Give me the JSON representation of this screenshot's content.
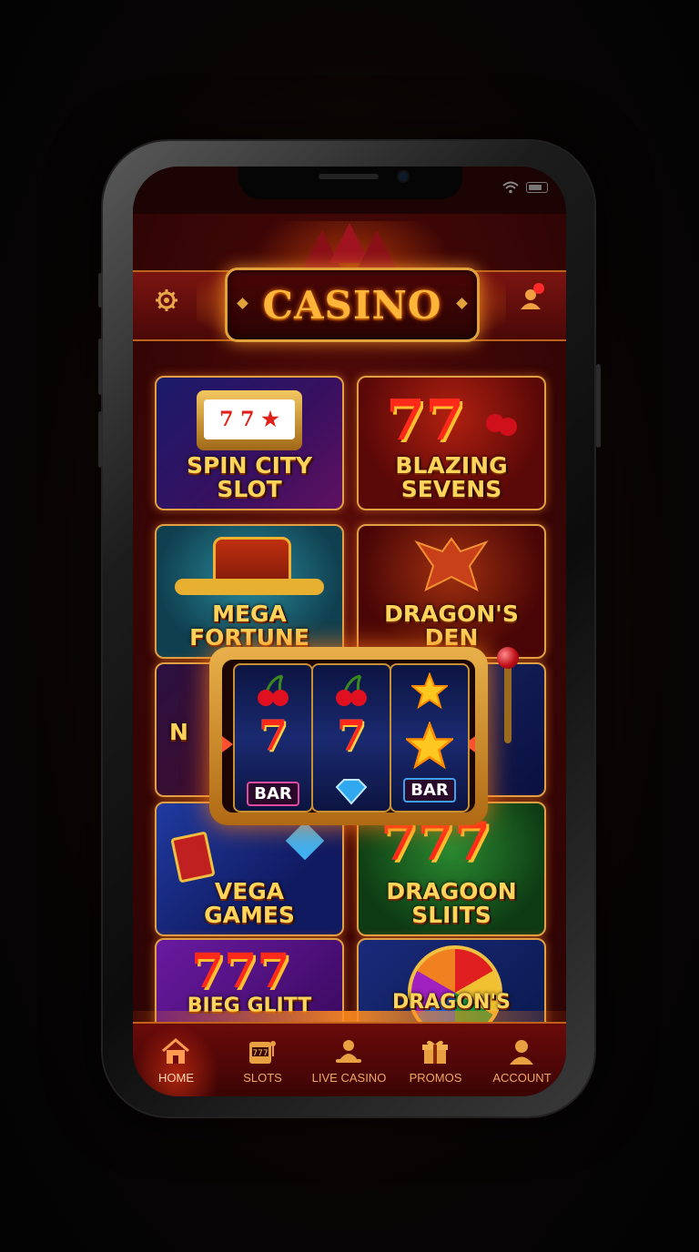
{
  "app": {
    "logo_text": "CASINO"
  },
  "header": {
    "settings_icon": "gear-icon",
    "account_icon": "user-icon",
    "notification": true
  },
  "games": [
    {
      "title_line1": "SPIN CITY",
      "title_line2": "SLOT",
      "theme": "slot-machine"
    },
    {
      "title_line1": "BLAZING",
      "title_line2": "SEVENS",
      "theme": "sevens-cherries"
    },
    {
      "title_line1": "MEGA",
      "title_line2": "FORTUNE",
      "theme": "treasure-chest"
    },
    {
      "title_line1": "DRAGON'S",
      "title_line2": "DEN",
      "theme": "dragon"
    },
    {
      "title_line1": "N",
      "title_line2": "",
      "theme": "partially-hidden"
    },
    {
      "title_line1": "",
      "title_line2": "",
      "theme": "partially-hidden"
    },
    {
      "title_line1": "VEGA",
      "title_line2": "GAMES",
      "theme": "cards-gems"
    },
    {
      "title_line1": "DRAGOON",
      "title_line2": "SLIITS",
      "theme": "triple-sevens"
    },
    {
      "title_line1": "BIEG GLITT",
      "title_line2": "",
      "theme": "triple-sevens"
    },
    {
      "title_line1": "DRAGON'S",
      "title_line2": "",
      "theme": "wheel"
    }
  ],
  "featured_slot": {
    "reels": [
      {
        "top": "cherries",
        "middle": "7",
        "bottom": "BAR"
      },
      {
        "top": "cherries",
        "middle": "7",
        "bottom": "diamond"
      },
      {
        "top": "star",
        "middle": "star",
        "bottom": "BAR"
      }
    ]
  },
  "nav": {
    "items": [
      {
        "label": "HOME",
        "icon": "home-icon",
        "active": true
      },
      {
        "label": "SLOTS",
        "icon": "slot-machine-icon",
        "active": false
      },
      {
        "label": "LIVE CASINO",
        "icon": "dealer-icon",
        "active": false
      },
      {
        "label": "PROMOS",
        "icon": "gift-icon",
        "active": false
      },
      {
        "label": "ACCOUNT",
        "icon": "user-icon",
        "active": false
      }
    ]
  },
  "colors": {
    "accent_gold": "#ffb43a",
    "background_red": "#3c0606",
    "border_gold": "#e2a045"
  }
}
